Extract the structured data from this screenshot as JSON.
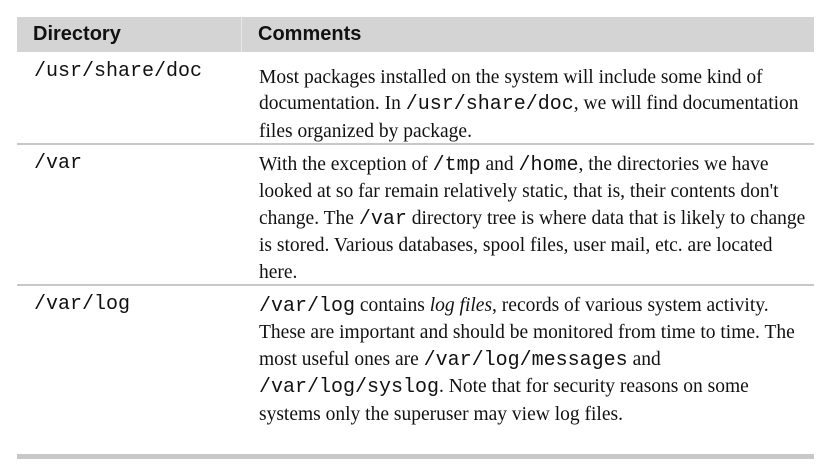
{
  "headers": {
    "directory": "Directory",
    "comments": "Comments"
  },
  "rows": [
    {
      "dir": "/usr/share/doc",
      "c": {
        "t0": "Most packages installed on the system will include some kind of documentation. In ",
        "m1": "/usr/share/doc",
        "t2": ", we will find documentation files organized by package."
      }
    },
    {
      "dir": "/var",
      "c": {
        "t0": "With the exception of ",
        "m1": "/tmp",
        "t2": " and ",
        "m3": "/home",
        "t4": ", the directories we have looked at so far remain relatively static, that is, their contents don't change. The ",
        "m5": "/var",
        "t6": " directory tree is where data that is likely to change is stored. Various databases, spool files, user mail, etc. are located here."
      }
    },
    {
      "dir": "/var/log",
      "c": {
        "m0": "/var/log",
        "t1": " contains ",
        "i2": "log files",
        "t3": ", records of various system activity. These are important and should be monitored from time to time. The most useful ones are ",
        "m4": "/var/log/messages",
        "t5": " and ",
        "m6": "/var/log/syslog",
        "t7": ". Note that for security reasons on some systems only the superuser may view log files."
      }
    }
  ]
}
